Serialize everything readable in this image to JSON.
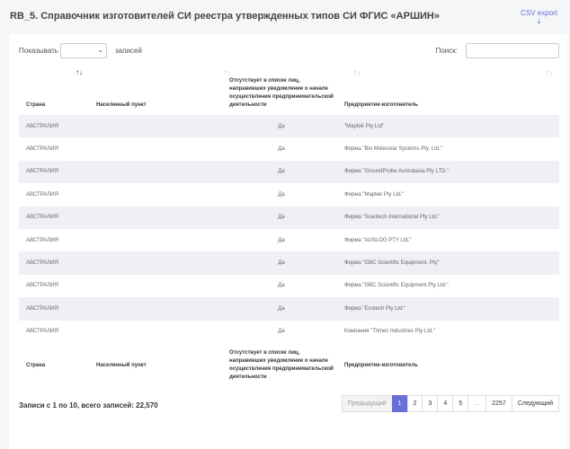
{
  "page": {
    "title": "RB_5. Справочник изготовителей СИ реестра утвержденных типов СИ ФГИС «АРШИН»",
    "csv_export": "CSV export",
    "download_icon": "download-icon"
  },
  "controls": {
    "show_label": "Показывать",
    "length_value": "",
    "entries_label": "записей",
    "search_label": "Поиск:",
    "search_value": ""
  },
  "table": {
    "columns": [
      "Страна",
      "Населенный пункт",
      "Отсутствует в списке лиц, направивших уведомление о начале осуществления предпринимательской деятельности",
      "Предприятие-изготовитель"
    ],
    "sort_icons": [
      "↑↓",
      "↑↓",
      "↑↓",
      "↑↓"
    ],
    "rows": [
      [
        "АВСТРАЛИЯ",
        "",
        "Да",
        "\"Maptek Pty Ltd\""
      ],
      [
        "АВСТРАЛИЯ",
        "",
        "Да",
        "Фирма \"Bio Molecular Systems Pty. Ltd.\""
      ],
      [
        "АВСТРАЛИЯ",
        "",
        "Да",
        "Фирма \"GroundProbe Australasia Pty LTD.\""
      ],
      [
        "АВСТРАЛИЯ",
        "",
        "Да",
        "Фирма \"Maptek Pty Ltd.\""
      ],
      [
        "АВСТРАЛИЯ",
        "",
        "Да",
        "Фирма \"Scantech International Pty Ltd.\""
      ],
      [
        "АВСТРАЛИЯ",
        "",
        "Да",
        "Фирма \"AUSLOG PTY Ltd.\""
      ],
      [
        "АВСТРАЛИЯ",
        "",
        "Да",
        "Фирма \"GBC Scientific Equipment, Pty\""
      ],
      [
        "АВСТРАЛИЯ",
        "",
        "Да",
        "Фирма \"GBC Scientific Equipment Pty Ltd.\""
      ],
      [
        "АВСТРАЛИЯ",
        "",
        "Да",
        "Фирма \"Ecotech Pty Ltd.\""
      ],
      [
        "АВСТРАЛИЯ",
        "",
        "Да",
        "Компания \"Trimec Industries Pty Ltd.\""
      ]
    ]
  },
  "footer": {
    "info": "Записи с 1 по 10, всего записей: 22,570",
    "prev": "Предыдущий",
    "pages": [
      "1",
      "2",
      "3",
      "4",
      "5",
      "…",
      "2257"
    ],
    "active_page": "1",
    "next": "Следующий"
  }
}
